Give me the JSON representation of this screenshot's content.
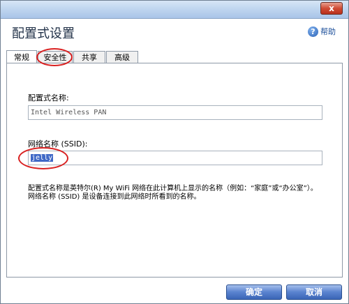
{
  "window": {
    "close_label": "x",
    "title": "配置式设置",
    "help_label": "帮助",
    "help_icon_glyph": "?"
  },
  "tabs": [
    {
      "label": "常规",
      "active": true
    },
    {
      "label": "安全性",
      "active": false
    },
    {
      "label": "共享",
      "active": false
    },
    {
      "label": "高级",
      "active": false
    }
  ],
  "profile_name": {
    "label": "配置式名称:",
    "value": "Intel Wireless PAN"
  },
  "ssid": {
    "label": "网络名称 (SSID):",
    "value": "jelly"
  },
  "description": "配置式名称是英特尔(R) My WiFi 网络在此计算机上显示的名称（例如：“家庭”或“办公室”）。网络名称 (SSID) 是设备连接到此网络时所看到的名称。",
  "buttons": {
    "ok": "确定",
    "cancel": "取消"
  },
  "colors": {
    "annotation": "#d92020",
    "button_blue": "#3a65b6",
    "selection": "#3f68c6"
  }
}
